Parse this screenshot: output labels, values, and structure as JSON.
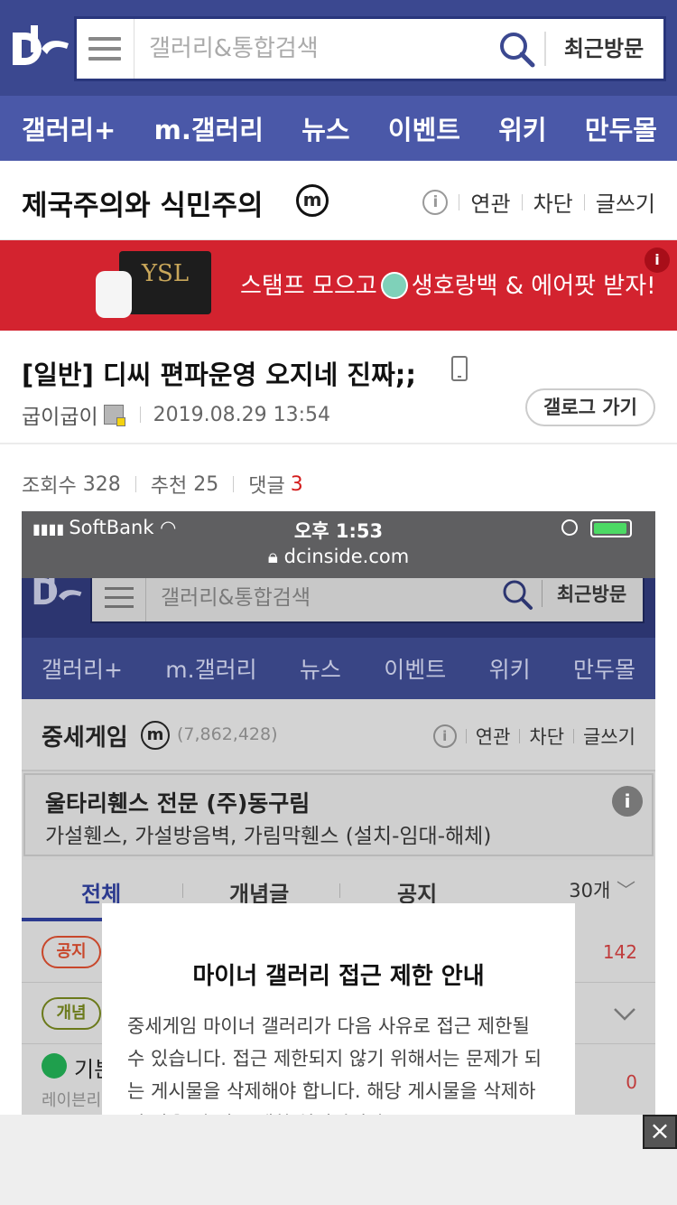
{
  "header": {
    "search_placeholder": "갤러리&통합검색",
    "recent_label": "최근방문",
    "colors": {
      "primary": "#3b4890",
      "nav": "#4a58a8"
    }
  },
  "nav": {
    "items": [
      {
        "label": "갤러리+"
      },
      {
        "label": "m.갤러리"
      },
      {
        "label": "뉴스"
      },
      {
        "label": "이벤트"
      },
      {
        "label": "위키"
      },
      {
        "label": "만두몰"
      }
    ]
  },
  "gallery": {
    "title": "제국주의와 식민주의",
    "minor_badge": "m",
    "info_icon": "i",
    "tools": {
      "related": "연관",
      "block": "차단",
      "write": "글쓰기"
    }
  },
  "ad_banner": {
    "text_before": "스탬프 모으고",
    "text_after": "생호랑백 & 에어팟 받자!",
    "bag_logo": "YSL",
    "info": "i",
    "color": "#d3232f"
  },
  "post": {
    "category": "[일반]",
    "title": "디씨 편파운영 오지네 진짜;;",
    "author": "굽이굽이",
    "date": "2019.08.29 13:54",
    "gallog_button": "갤로그 가기",
    "stats": {
      "views_label": "조회수",
      "views": "328",
      "likes_label": "추천",
      "likes": "25",
      "comments_label": "댓글",
      "comments": "3"
    }
  },
  "embedded": {
    "status": {
      "carrier": "SoftBank",
      "time": "오후 1:53",
      "url": "dcinside.com"
    },
    "search_placeholder": "갤러리&통합검색",
    "recent_label": "최근방문",
    "nav": [
      "갤러리+",
      "m.갤러리",
      "뉴스",
      "이벤트",
      "위키",
      "만두몰"
    ],
    "gallery_title": "중세게임",
    "minor_badge": "m",
    "member_count": "(7,862,428)",
    "info_icon": "i",
    "tools": {
      "related": "연관",
      "block": "차단",
      "write": "글쓰기"
    },
    "ad": {
      "title": "울타리휀스 전문 (주)동구림",
      "subtitle": "가설휀스, 가설방음벽, 가림막휀스 (설치-임대-해체)",
      "info": "i"
    },
    "tabs": {
      "all": "전체",
      "concept": "개념글",
      "notice": "공지",
      "count": "30개"
    },
    "rows": {
      "notice_badge": "공지",
      "notice_num": "142",
      "concept_badge": "개념",
      "user_text": "기본",
      "user_sub": "레이븐리",
      "user_num": "0"
    },
    "modal": {
      "title": "마이너 갤러리 접근 제한 안내",
      "body": "중세게임 마이너 갤러리가 다음 사유로 접근 제한될 수 있습니다. 접근 제한되지 않기 위해서는 문제가 되는 게시물을 삭제해야 합니다. 해당 게시물을 삭제하지 않을 시 접근 제한 처리됩니다."
    }
  },
  "bottom_ad": {
    "close": "×"
  }
}
